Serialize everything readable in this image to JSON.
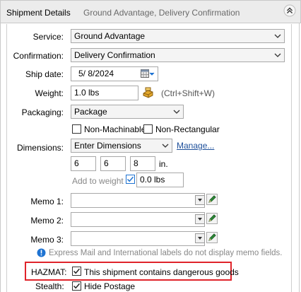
{
  "header": {
    "title": "Shipment Details",
    "subtitle": "Ground Advantage, Delivery Confirmation"
  },
  "service": {
    "label": "Service:",
    "value": "Ground Advantage"
  },
  "confirmation": {
    "label": "Confirmation:",
    "value": "Delivery Confirmation"
  },
  "ship_date": {
    "label": "Ship date:",
    "value": "5/  8/2024"
  },
  "weight": {
    "label": "Weight:",
    "value": "1.0 lbs",
    "shortcut": "(Ctrl+Shift+W)"
  },
  "packaging": {
    "label": "Packaging:",
    "value": "Package",
    "non_machinable": "Non-Machinable",
    "non_rectangular": "Non-Rectangular"
  },
  "dimensions": {
    "label": "Dimensions:",
    "value": "Enter Dimensions",
    "manage": "Manage...",
    "l": "6",
    "w": "6",
    "h": "8",
    "unit": "in.",
    "add_to_weight": "Add to weight",
    "extra_weight": "0.0 lbs"
  },
  "memos": [
    {
      "label": "Memo 1:"
    },
    {
      "label": "Memo 2:"
    },
    {
      "label": "Memo 3:"
    }
  ],
  "memo_note": "Express Mail and International labels do not display memo fields.",
  "hazmat": {
    "label": "HAZMAT:",
    "text": "This shipment contains dangerous goods"
  },
  "stealth": {
    "label": "Stealth:",
    "text": "Hide Postage"
  },
  "colors": {
    "highlight": "#e0242b",
    "link": "#1d4f9a",
    "info_icon": "#1e73d2"
  }
}
